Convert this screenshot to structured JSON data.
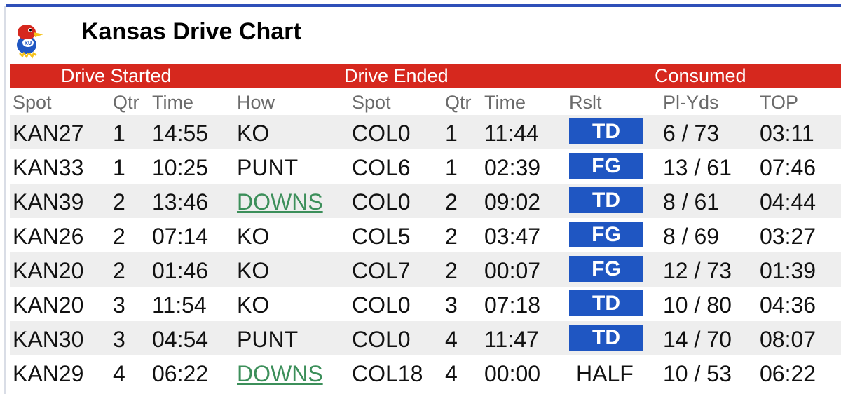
{
  "header": {
    "title": "Kansas Drive Chart",
    "logo_icon": "jayhawk-logo-icon"
  },
  "groups": {
    "started": "Drive Started",
    "ended": "Drive Ended",
    "consumed": "Consumed"
  },
  "columns": {
    "spot": "Spot",
    "qtr": "Qtr",
    "time": "Time",
    "how": "How",
    "end_spot": "Spot",
    "end_qtr": "Qtr",
    "end_time": "Time",
    "rslt": "Rslt",
    "pl_yds": "Pl-Yds",
    "top": "TOP"
  },
  "rows": [
    {
      "spot": "KAN27",
      "qtr": "1",
      "time": "14:55",
      "how": "KO",
      "how_link": false,
      "end_spot": "COL0",
      "end_qtr": "1",
      "end_time": "11:44",
      "rslt": "TD",
      "badge": true,
      "pl_yds": "6 / 73",
      "top": "03:11"
    },
    {
      "spot": "KAN33",
      "qtr": "1",
      "time": "10:25",
      "how": "PUNT",
      "how_link": false,
      "end_spot": "COL6",
      "end_qtr": "1",
      "end_time": "02:39",
      "rslt": "FG",
      "badge": true,
      "pl_yds": "13 / 61",
      "top": "07:46"
    },
    {
      "spot": "KAN39",
      "qtr": "2",
      "time": "13:46",
      "how": "DOWNS",
      "how_link": true,
      "end_spot": "COL0",
      "end_qtr": "2",
      "end_time": "09:02",
      "rslt": "TD",
      "badge": true,
      "pl_yds": "8 / 61",
      "top": "04:44"
    },
    {
      "spot": "KAN26",
      "qtr": "2",
      "time": "07:14",
      "how": "KO",
      "how_link": false,
      "end_spot": "COL5",
      "end_qtr": "2",
      "end_time": "03:47",
      "rslt": "FG",
      "badge": true,
      "pl_yds": "8 / 69",
      "top": "03:27"
    },
    {
      "spot": "KAN20",
      "qtr": "2",
      "time": "01:46",
      "how": "KO",
      "how_link": false,
      "end_spot": "COL7",
      "end_qtr": "2",
      "end_time": "00:07",
      "rslt": "FG",
      "badge": true,
      "pl_yds": "12 / 73",
      "top": "01:39"
    },
    {
      "spot": "KAN20",
      "qtr": "3",
      "time": "11:54",
      "how": "KO",
      "how_link": false,
      "end_spot": "COL0",
      "end_qtr": "3",
      "end_time": "07:18",
      "rslt": "TD",
      "badge": true,
      "pl_yds": "10 / 80",
      "top": "04:36"
    },
    {
      "spot": "KAN30",
      "qtr": "3",
      "time": "04:54",
      "how": "PUNT",
      "how_link": false,
      "end_spot": "COL0",
      "end_qtr": "4",
      "end_time": "11:47",
      "rslt": "TD",
      "badge": true,
      "pl_yds": "14 / 70",
      "top": "08:07"
    },
    {
      "spot": "KAN29",
      "qtr": "4",
      "time": "06:22",
      "how": "DOWNS",
      "how_link": true,
      "end_spot": "COL18",
      "end_qtr": "4",
      "end_time": "00:00",
      "rslt": "HALF",
      "badge": false,
      "pl_yds": "10 / 53",
      "top": "06:22"
    }
  ],
  "colors": {
    "group_bar": "#d6281e",
    "badge": "#1f56c2",
    "link": "#3c8f5a",
    "alt_row": "#eeeeee",
    "accent_line": "#2f4fb8"
  }
}
